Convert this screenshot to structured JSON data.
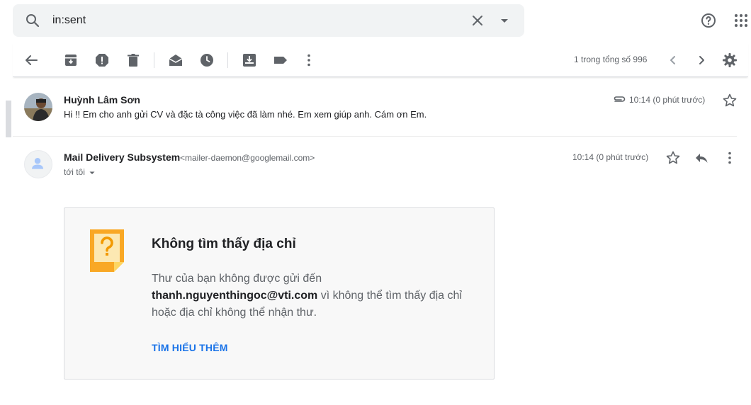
{
  "search": {
    "query": "in:sent"
  },
  "pager": {
    "text": "1 trong tổng số 996"
  },
  "thread": [
    {
      "sender": "Huỳnh Lâm Sơn",
      "snippet": "Hi !! Em cho anh gửi CV và đặc tà công việc đã làm nhé. Em xem giúp anh. Cám ơn Em.",
      "time": "10:14 (0 phút trước)",
      "has_attachment": true
    },
    {
      "sender": "Mail Delivery Subsystem",
      "sender_email": "<mailer-daemon@googlemail.com>",
      "to": "tới tôi",
      "time": "10:14 (0 phút trước)"
    }
  ],
  "bounce": {
    "title": "Không tìm thấy địa chỉ",
    "body_prefix": "Thư của bạn không được gửi đến",
    "address": "thanh.nguyenthingoc@vti.com",
    "body_suffix": "vì không thể tìm thấy địa chỉ hoặc địa chỉ không thể nhận thư.",
    "link": "TÌM HIỂU THÊM"
  },
  "colors": {
    "accent": "#1a73e8",
    "icon": "#5f6368",
    "note": "#f9a825"
  },
  "icons": [
    "search-icon",
    "clear-icon",
    "search-options-icon",
    "help-icon",
    "apps-icon",
    "back-icon",
    "archive-icon",
    "report-spam-icon",
    "delete-icon",
    "mark-unread-icon",
    "snooze-icon",
    "move-to-icon",
    "label-icon",
    "more-icon",
    "prev-icon",
    "next-icon",
    "settings-icon",
    "attachment-icon",
    "star-icon",
    "reply-icon"
  ]
}
